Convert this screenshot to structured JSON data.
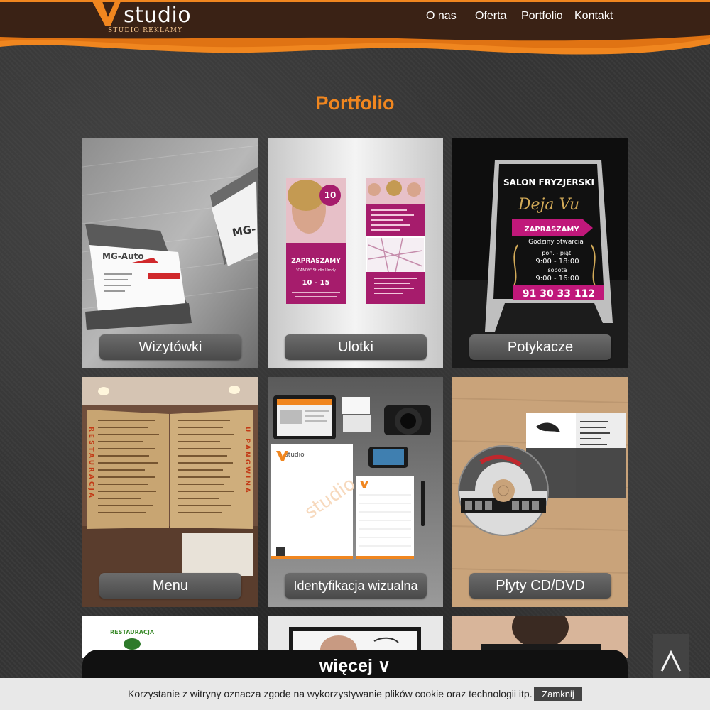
{
  "header": {
    "logo_text": "studio",
    "logo_tagline": "STUDIO REKLAMY",
    "nav": [
      "O nas",
      "Oferta",
      "Portfolio",
      "Kontakt"
    ]
  },
  "main": {
    "title": "Portfolio",
    "tiles": [
      {
        "label": "Wizytówki",
        "icon": "business-cards-photo"
      },
      {
        "label": "Ulotki",
        "icon": "flyers-photo"
      },
      {
        "label": "Potykacze",
        "icon": "a-frame-sign-photo"
      },
      {
        "label": "Menu",
        "icon": "restaurant-menu-photo"
      },
      {
        "label": "Identyfikacja wizualna",
        "icon": "branding-photo"
      },
      {
        "label": "Płyty CD/DVD",
        "icon": "cd-dvd-photo"
      }
    ],
    "samples": {
      "card_brand": "MG-Auto",
      "card_brand_2": "MG-",
      "flyer_title": "ZAPRASZAMY",
      "flyer_badge": "10",
      "flyer_subtitle": "\"CANDY\" Studio Urody",
      "flyer_hours": "10 - 15",
      "sign_title": "SALON FRYZJERSKI",
      "sign_name": "Deja Vu",
      "sign_cta": "ZAPRASZAMY",
      "sign_hours_label": "Godziny otwarcia",
      "sign_days_1": "pon. - piąt.",
      "sign_hours_1": "9:00 - 18:00",
      "sign_days_2": "sobota",
      "sign_hours_2": "9:00 - 16:00",
      "sign_phone": "91 30 33 112",
      "menu_left": "RESTAURACJA",
      "menu_right": "U PANGWINA",
      "ident_logo": "studio",
      "restaurant_peek": "RESTAURACJA"
    },
    "more_label": "więcej ∨"
  },
  "to_top_symbol": "Λ",
  "cookie": {
    "text": "Korzystanie z witryny oznacza zgodę na wykorzystywanie plików cookie oraz technologii itp.",
    "button": "Zamknij"
  },
  "colors": {
    "accent": "#f0861f",
    "header_bg": "#3a2215",
    "page_bg": "#363636"
  }
}
